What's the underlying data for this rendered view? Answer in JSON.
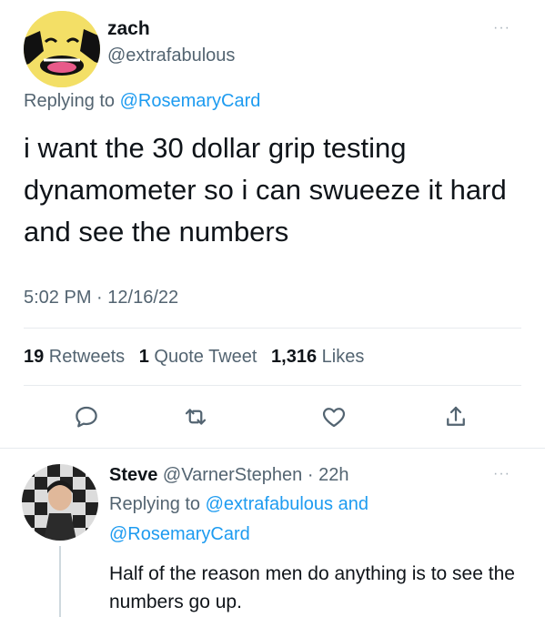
{
  "tweet": {
    "author_name": "zach",
    "author_handle": "@extrafabulous",
    "more_label": "···",
    "replying_prefix": "Replying to ",
    "replying_to": "@RosemaryCard",
    "text": "i want the 30 dollar grip testing dynamometer so i can swueeze it hard and see the numbers",
    "time": "5:02 PM",
    "separator": " · ",
    "date": "12/16/22"
  },
  "stats": {
    "retweets_count": "19",
    "retweets_label": " Retweets",
    "quotes_count": "1",
    "quotes_label": " Quote Tweet",
    "likes_count": "1,316",
    "likes_label": " Likes"
  },
  "actions": [
    {
      "icon": "reply-icon"
    },
    {
      "icon": "retweet-icon"
    },
    {
      "icon": "like-icon"
    },
    {
      "icon": "share-icon"
    }
  ],
  "reply": {
    "author_name": "Steve",
    "author_handle": " @VarnerStephen",
    "time": " · 22h",
    "more_label": "···",
    "replying_prefix": "Replying to ",
    "replying_to_1": "@extrafabulous",
    "replying_and": " and",
    "replying_to_2": "@RosemaryCard",
    "text": "Half of the reason men do anything is to see the numbers go up."
  },
  "colors": {
    "accent": "#1d9bf0",
    "muted": "#536471",
    "text": "#0f1419"
  }
}
